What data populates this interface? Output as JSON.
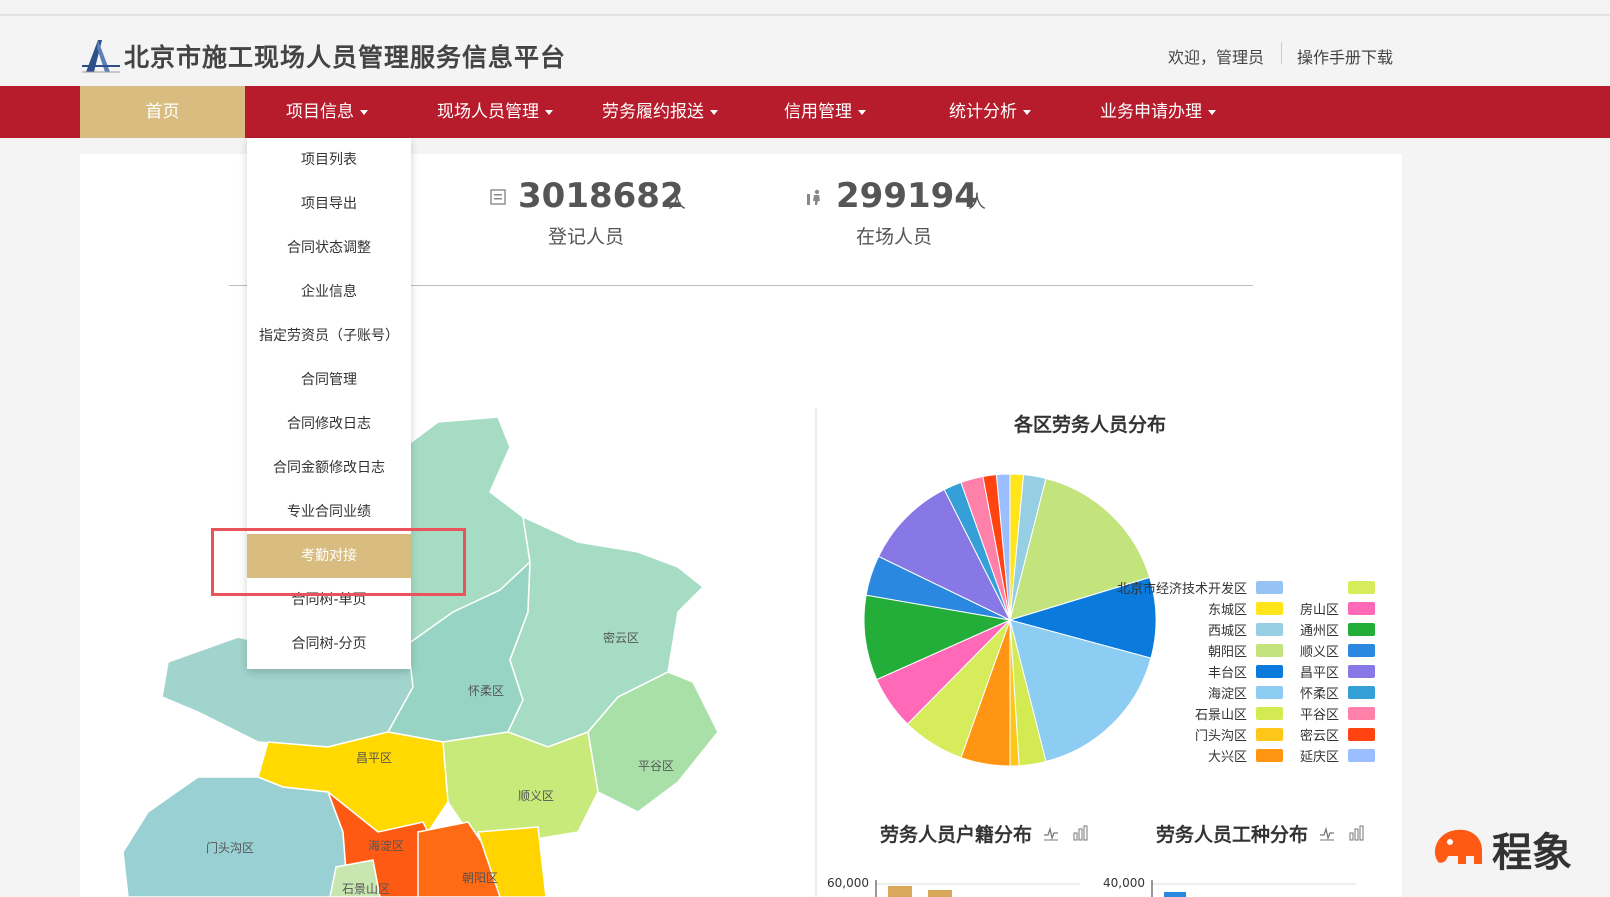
{
  "header": {
    "site_title": "北京市施工现场人员管理服务信息平台",
    "welcome": "欢迎，管理员",
    "manual_link": "操作手册下载"
  },
  "nav": {
    "items": [
      {
        "label": "首页"
      },
      {
        "label": "项目信息"
      },
      {
        "label": "现场人员管理"
      },
      {
        "label": "劳务履约报送"
      },
      {
        "label": "信用管理"
      },
      {
        "label": "统计分析"
      },
      {
        "label": "业务申请办理"
      }
    ]
  },
  "dropdown": {
    "items": [
      {
        "label": "项目列表"
      },
      {
        "label": "项目导出"
      },
      {
        "label": "合同状态调整"
      },
      {
        "label": "企业信息"
      },
      {
        "label": "指定劳资员（子账号）"
      },
      {
        "label": "合同管理"
      },
      {
        "label": "合同修改日志"
      },
      {
        "label": "合同金额修改日志"
      },
      {
        "label": "专业合同业绩"
      },
      {
        "label": "考勤对接"
      },
      {
        "label": "合同树-单页"
      },
      {
        "label": "合同树-分页"
      }
    ],
    "active_index": 9
  },
  "stats": {
    "registered": {
      "value": "3018682",
      "unit": "人",
      "label": "登记人员"
    },
    "onsite": {
      "value": "299194",
      "unit": "人",
      "label": "在场人员"
    }
  },
  "map": {
    "districts": [
      "密云区",
      "怀柔区",
      "昌平区",
      "顺义区",
      "平谷区",
      "门头沟区",
      "海淀区",
      "朝阳区",
      "石景山区"
    ]
  },
  "charts": {
    "household_title": "劳务人员户籍分布",
    "worktype_title": "劳务人员工种分布",
    "household_ytick": "60,000",
    "worktype_ytick": "40,000"
  },
  "chart_data": [
    {
      "type": "pie",
      "title": "各区劳务人员分布",
      "slices": [
        {
          "name": "东城区",
          "value": 1.5,
          "color": "#ffe51a"
        },
        {
          "name": "西城区",
          "value": 2.5,
          "color": "#96cfe4"
        },
        {
          "name": "朝阳区",
          "value": 16.5,
          "color": "#c3e47c"
        },
        {
          "name": "丰台区",
          "value": 9.0,
          "color": "#0a7bdc"
        },
        {
          "name": "海淀区",
          "value": 17.0,
          "color": "#8dcdf4"
        },
        {
          "name": "石景山区",
          "value": 3.0,
          "color": "#d4ea52"
        },
        {
          "name": "门头沟区",
          "value": 1.0,
          "color": "#ffc61a"
        },
        {
          "name": "大兴区",
          "value": 5.5,
          "color": "#ff9512"
        },
        {
          "name": "北京市经济技术开发区",
          "value": 7.0,
          "color": "#d6ec5a"
        },
        {
          "name": "房山区",
          "value": 6.0,
          "color": "#ff69b8"
        },
        {
          "name": "通州区",
          "value": 9.5,
          "color": "#22ae38"
        },
        {
          "name": "顺义区",
          "value": 4.5,
          "color": "#2a88e0"
        },
        {
          "name": "昌平区",
          "value": 10.5,
          "color": "#8878e6"
        },
        {
          "name": "怀柔区",
          "value": 2.0,
          "color": "#359fd8"
        },
        {
          "name": "平谷区",
          "value": 2.5,
          "color": "#ff80a8"
        },
        {
          "name": "密云区",
          "value": 1.5,
          "color": "#ff4412"
        },
        {
          "name": "延庆区",
          "value": 1.5,
          "color": "#9abeff"
        }
      ],
      "legend_left": [
        {
          "name": "北京市经济技术开发区",
          "color": "#96c3f4"
        },
        {
          "name": "东城区",
          "color": "#ffe51a"
        },
        {
          "name": "西城区",
          "color": "#96cfe4"
        },
        {
          "name": "朝阳区",
          "color": "#c3e47c"
        },
        {
          "name": "丰台区",
          "color": "#0a7bdc"
        },
        {
          "name": "海淀区",
          "color": "#8dcdf4"
        },
        {
          "name": "石景山区",
          "color": "#d4ea52"
        },
        {
          "name": "门头沟区",
          "color": "#ffc61a"
        },
        {
          "name": "大兴区",
          "color": "#ff9512"
        }
      ],
      "legend_right": [
        {
          "name": "",
          "color": "#d6ec5a"
        },
        {
          "name": "房山区",
          "color": "#ff69b8"
        },
        {
          "name": "通州区",
          "color": "#22ae38"
        },
        {
          "name": "顺义区",
          "color": "#2a88e0"
        },
        {
          "name": "昌平区",
          "color": "#8878e6"
        },
        {
          "name": "怀柔区",
          "color": "#359fd8"
        },
        {
          "name": "平谷区",
          "color": "#ff80a8"
        },
        {
          "name": "密云区",
          "color": "#ff4412"
        },
        {
          "name": "延庆区",
          "color": "#9abeff"
        }
      ]
    }
  ],
  "watermark": {
    "text": "程象"
  },
  "colors": {
    "nav_bg": "#b71c2c",
    "nav_active": "#d9bd80",
    "highlight_border": "#e8535c"
  }
}
